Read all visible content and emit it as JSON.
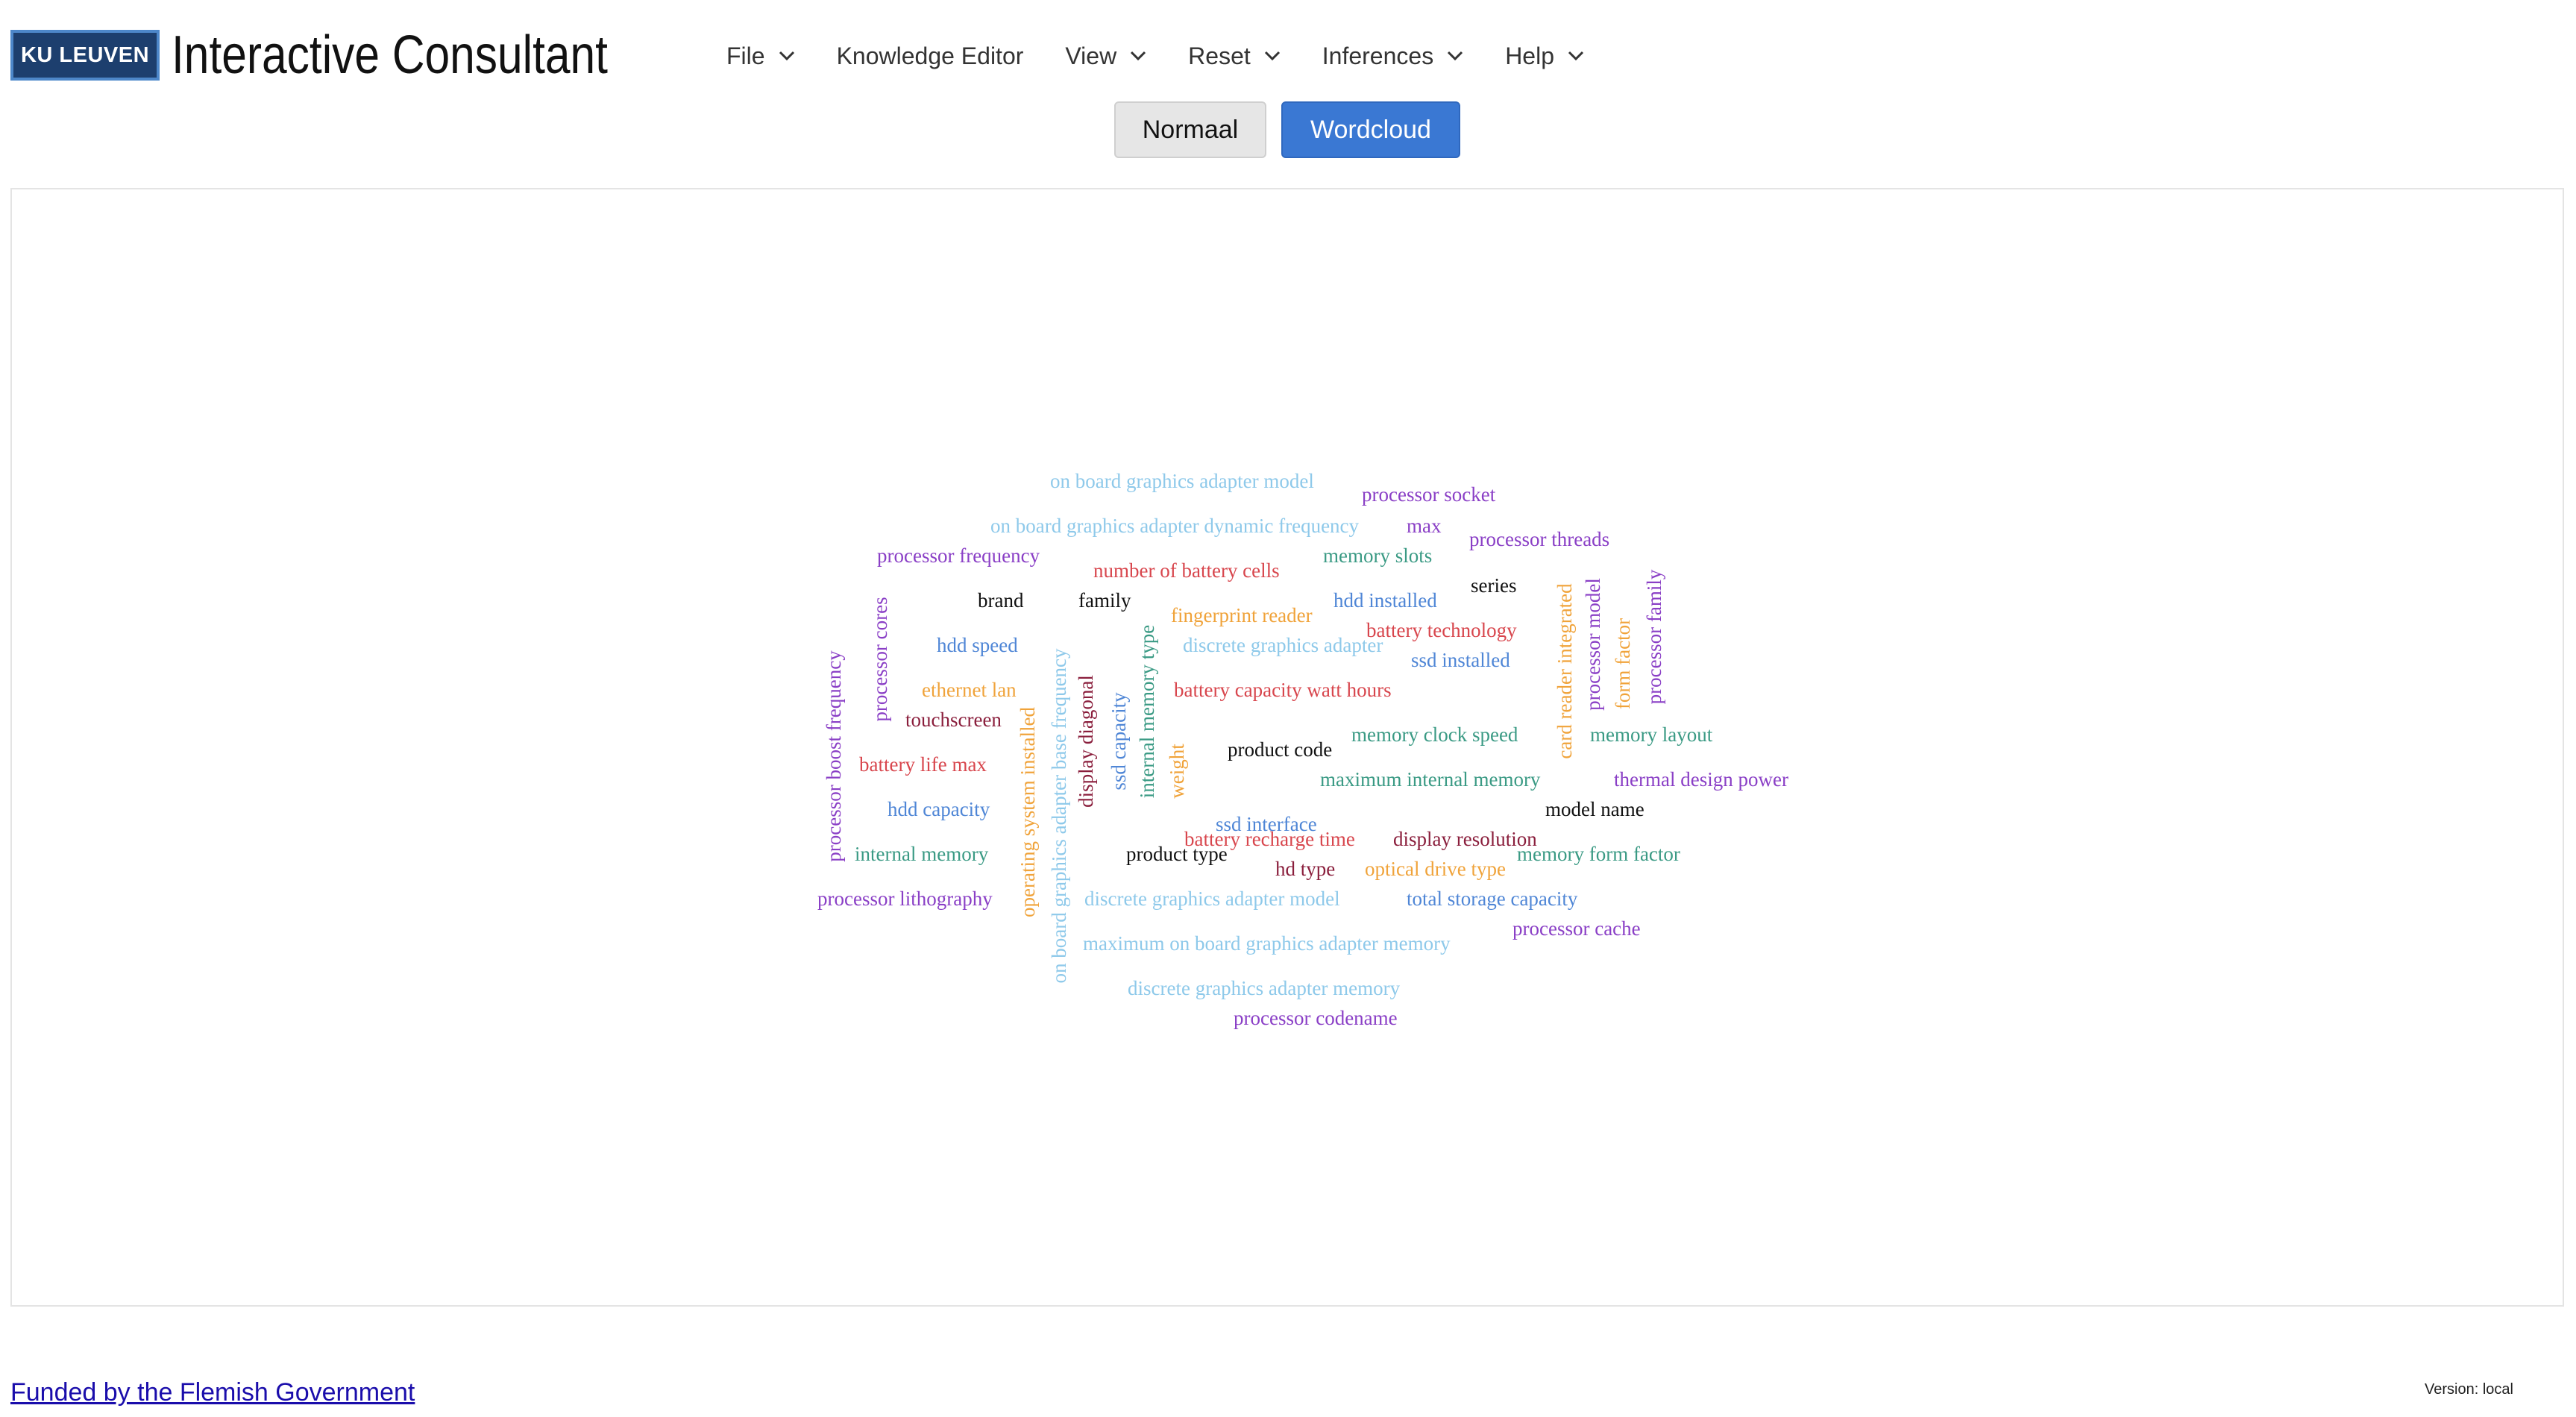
{
  "header": {
    "logo_text": "KU LEUVEN",
    "app_title": "Interactive Consultant",
    "menu": [
      {
        "label": "File",
        "icon": "chevron-down-icon"
      },
      {
        "label": "Knowledge Editor"
      },
      {
        "label": "View",
        "icon": "chevron-down-icon"
      },
      {
        "label": "Reset",
        "icon": "chevron-down-icon"
      },
      {
        "label": "Inferences",
        "icon": "chevron-down-icon"
      },
      {
        "label": "Help",
        "icon": "chevron-down-icon"
      }
    ]
  },
  "view_toggle": {
    "normaal_label": "Normaal",
    "wordcloud_label": "Wordcloud",
    "active": "Wordcloud"
  },
  "wordcloud": {
    "words": [
      {
        "text": "on board graphics adapter model",
        "color": "#8ec9ea",
        "rotated": false
      },
      {
        "text": "processor socket",
        "color": "#8a3fc6",
        "rotated": false
      },
      {
        "text": "on board graphics adapter dynamic frequency",
        "color": "#8ec9ea",
        "rotated": false
      },
      {
        "text": "max",
        "color": "#8a3fc6",
        "rotated": false
      },
      {
        "text": "processor threads",
        "color": "#8a3fc6",
        "rotated": false
      },
      {
        "text": "processor frequency",
        "color": "#8a3fc6",
        "rotated": false
      },
      {
        "text": "number of battery cells",
        "color": "#d8464d",
        "rotated": false
      },
      {
        "text": "memory slots",
        "color": "#3a9a84",
        "rotated": false
      },
      {
        "text": "brand",
        "color": "#111111",
        "rotated": false
      },
      {
        "text": "family",
        "color": "#111111",
        "rotated": false
      },
      {
        "text": "hdd installed",
        "color": "#4f86d6",
        "rotated": false
      },
      {
        "text": "series",
        "color": "#111111",
        "rotated": false
      },
      {
        "text": "fingerprint reader",
        "color": "#f0a33a",
        "rotated": false
      },
      {
        "text": "battery technology",
        "color": "#d8464d",
        "rotated": false
      },
      {
        "text": "hdd speed",
        "color": "#4f86d6",
        "rotated": false
      },
      {
        "text": "discrete graphics adapter",
        "color": "#8ec9ea",
        "rotated": false
      },
      {
        "text": "ssd installed",
        "color": "#4f86d6",
        "rotated": false
      },
      {
        "text": "ethernet lan",
        "color": "#f0a33a",
        "rotated": false
      },
      {
        "text": "battery capacity watt hours",
        "color": "#d8464d",
        "rotated": false
      },
      {
        "text": "touchscreen",
        "color": "#8a1e3c",
        "rotated": false
      },
      {
        "text": "memory clock speed",
        "color": "#3a9a84",
        "rotated": false
      },
      {
        "text": "memory layout",
        "color": "#3a9a84",
        "rotated": false
      },
      {
        "text": "product code",
        "color": "#111111",
        "rotated": false
      },
      {
        "text": "battery life max",
        "color": "#d8464d",
        "rotated": false
      },
      {
        "text": "maximum internal memory",
        "color": "#3a9a84",
        "rotated": false
      },
      {
        "text": "thermal design power",
        "color": "#8a3fc6",
        "rotated": false
      },
      {
        "text": "hdd capacity",
        "color": "#4f86d6",
        "rotated": false
      },
      {
        "text": "ssd interface",
        "color": "#4f86d6",
        "rotated": false
      },
      {
        "text": "model name",
        "color": "#111111",
        "rotated": false
      },
      {
        "text": "battery recharge time",
        "color": "#d8464d",
        "rotated": false
      },
      {
        "text": "display resolution",
        "color": "#8a1e3c",
        "rotated": false
      },
      {
        "text": "internal memory",
        "color": "#3a9a84",
        "rotated": false
      },
      {
        "text": "product type",
        "color": "#111111",
        "rotated": false
      },
      {
        "text": "memory form factor",
        "color": "#3a9a84",
        "rotated": false
      },
      {
        "text": "hd type",
        "color": "#8a1e3c",
        "rotated": false
      },
      {
        "text": "optical drive type",
        "color": "#f0a33a",
        "rotated": false
      },
      {
        "text": "processor lithography",
        "color": "#8a3fc6",
        "rotated": false
      },
      {
        "text": "discrete graphics adapter model",
        "color": "#8ec9ea",
        "rotated": false
      },
      {
        "text": "total storage capacity",
        "color": "#4f86d6",
        "rotated": false
      },
      {
        "text": "processor cache",
        "color": "#8a3fc6",
        "rotated": false
      },
      {
        "text": "maximum on board graphics adapter memory",
        "color": "#8ec9ea",
        "rotated": false
      },
      {
        "text": "discrete graphics adapter memory",
        "color": "#8ec9ea",
        "rotated": false
      },
      {
        "text": "processor codename",
        "color": "#8a3fc6",
        "rotated": false
      },
      {
        "text": "processor boost frequency",
        "color": "#8a3fc6",
        "rotated": true
      },
      {
        "text": "processor cores",
        "color": "#8a3fc6",
        "rotated": true
      },
      {
        "text": "operating system installed",
        "color": "#f0a33a",
        "rotated": true
      },
      {
        "text": "on board graphics adapter base frequency",
        "color": "#8ec9ea",
        "rotated": true
      },
      {
        "text": "display diagonal",
        "color": "#8a1e3c",
        "rotated": true
      },
      {
        "text": "ssd capacity",
        "color": "#4f86d6",
        "rotated": true
      },
      {
        "text": "internal memory type",
        "color": "#3a9a84",
        "rotated": true
      },
      {
        "text": "weight",
        "color": "#f0a33a",
        "rotated": true
      },
      {
        "text": "card reader integrated",
        "color": "#f0a33a",
        "rotated": true
      },
      {
        "text": "processor model",
        "color": "#8a3fc6",
        "rotated": true
      },
      {
        "text": "form factor",
        "color": "#f0a33a",
        "rotated": true
      },
      {
        "text": "processor family",
        "color": "#8a3fc6",
        "rotated": true
      }
    ]
  },
  "footer": {
    "funded_link": "Funded by the Flemish Government",
    "version": "Version: local"
  }
}
